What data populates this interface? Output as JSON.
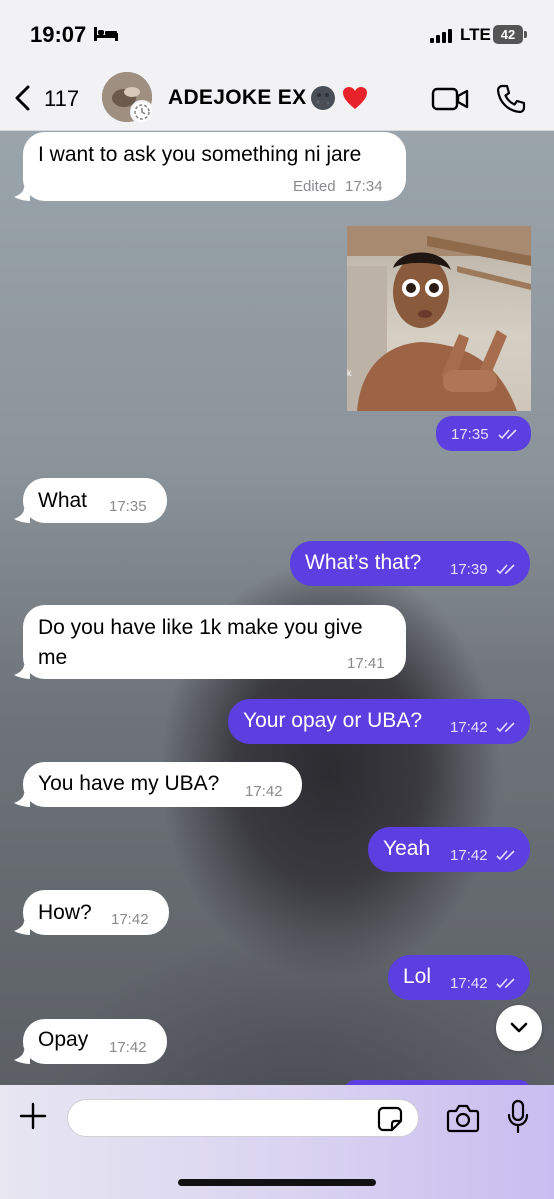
{
  "status_bar": {
    "time": "19:07",
    "network": "LTE",
    "battery": "42",
    "icons": [
      "bed-icon",
      "signal-icon",
      "battery-icon"
    ]
  },
  "header": {
    "back_count": "117",
    "contact_name": "ADEJOKE EX",
    "name_emojis": [
      "new-moon-face-icon",
      "red-heart-icon"
    ],
    "icons": [
      "back-chevron-icon",
      "video-call-icon",
      "phone-call-icon"
    ]
  },
  "messages": [
    {
      "direction": "in",
      "text": "I want to ask you something ni jare",
      "edited_label": "Edited",
      "time": "17:34"
    },
    {
      "direction": "out",
      "type": "image",
      "time": "17:35",
      "status": "read"
    },
    {
      "direction": "in",
      "text": "What",
      "time": "17:35"
    },
    {
      "direction": "out",
      "text": "What’s that?",
      "time": "17:39",
      "status": "read"
    },
    {
      "direction": "in",
      "text_line1": "Do you have like 1k make you give",
      "text_line2": "me",
      "time": "17:41"
    },
    {
      "direction": "out",
      "text": "Your opay or UBA?",
      "time": "17:42",
      "status": "read"
    },
    {
      "direction": "in",
      "text": "You have my UBA?",
      "time": "17:42"
    },
    {
      "direction": "out",
      "text": "Yeah",
      "time": "17:42",
      "status": "read"
    },
    {
      "direction": "in",
      "text": "How?",
      "time": "17:42"
    },
    {
      "direction": "out",
      "text": "Lol",
      "time": "17:42",
      "status": "read"
    },
    {
      "direction": "in",
      "text": "Opay",
      "time": "17:42"
    }
  ],
  "composer": {
    "placeholder": "",
    "icons": [
      "plus-icon",
      "sticker-icon",
      "camera-icon",
      "microphone-icon"
    ]
  },
  "colors": {
    "outgoing_bubble": "#5b3fe0",
    "incoming_bubble": "#ffffff",
    "bars": "#f2f2f4"
  }
}
